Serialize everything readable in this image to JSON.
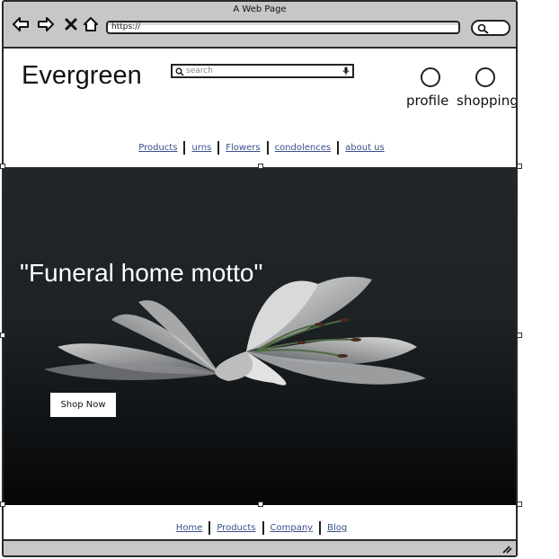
{
  "window": {
    "title": "A Web Page"
  },
  "browser": {
    "url": "https://"
  },
  "header": {
    "brand": "Evergreen",
    "search_placeholder": "search",
    "profile_label": "profile",
    "bag_label": "shopping bag"
  },
  "top_nav": [
    "Products",
    "urns",
    "Flowers",
    "condolences",
    "about us"
  ],
  "hero": {
    "motto": "\"Funeral home motto\"",
    "cta_label": "Shop Now"
  },
  "footer_nav": [
    "Home",
    "Products",
    "Company",
    "Blog"
  ],
  "colors": {
    "chrome": "#c7c7c7",
    "link": "#3a4f8a",
    "hero_bg": "#1d2225"
  }
}
